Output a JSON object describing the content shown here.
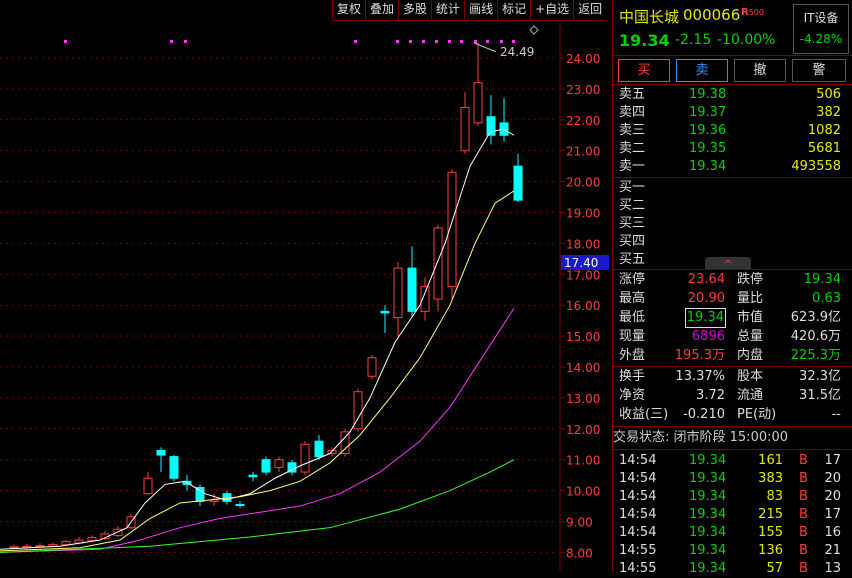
{
  "toolbar": {
    "items": [
      "复权",
      "叠加",
      "多股",
      "统计",
      "画线",
      "标记",
      "+自选",
      "返回"
    ]
  },
  "chart": {
    "price_labels": [
      "24.00",
      "23.00",
      "22.00",
      "21.00",
      "20.00",
      "19.00",
      "18.00",
      "17.00",
      "16.00",
      "15.00",
      "14.00",
      "13.00",
      "12.00",
      "11.00",
      "10.00",
      "9.00",
      "8.00"
    ],
    "current_price_tag": "17.40",
    "high_annotation": "24.49",
    "colors": {
      "up": "#ff3b3b",
      "down": "#00ffff",
      "ma5": "#ffffff",
      "ma10": "#ffff66",
      "ma20": "#ff33ff",
      "ma60": "#33ff33"
    }
  },
  "quote": {
    "name": "中国长城",
    "code": "000066",
    "r_badge": "R",
    "r_value": "500",
    "price": "19.34",
    "change": "-2.15",
    "change_pct": "-10.00%",
    "sector_name": "IT设备",
    "sector_pct": "-4.28%"
  },
  "actions": {
    "buy": "买",
    "sell": "卖",
    "cancel": "撤",
    "alert": "警"
  },
  "asks": [
    {
      "label": "卖五",
      "price": "19.38",
      "vol": "506"
    },
    {
      "label": "卖四",
      "price": "19.37",
      "vol": "382"
    },
    {
      "label": "卖三",
      "price": "19.36",
      "vol": "1082"
    },
    {
      "label": "卖二",
      "price": "19.35",
      "vol": "5681"
    },
    {
      "label": "卖一",
      "price": "19.34",
      "vol": "493558"
    }
  ],
  "bids": [
    {
      "label": "买一"
    },
    {
      "label": "买二"
    },
    {
      "label": "买三"
    },
    {
      "label": "买四"
    },
    {
      "label": "买五"
    }
  ],
  "expand_icon": "^",
  "stats": [
    {
      "l1": "涨停",
      "v1": "23.64",
      "c1": "red",
      "l2": "跌停",
      "v2": "19.34",
      "c2": "green"
    },
    {
      "l1": "最高",
      "v1": "20.90",
      "c1": "red",
      "l2": "量比",
      "v2": "0.63",
      "c2": "green"
    },
    {
      "l1": "最低",
      "v1": "19.34",
      "c1": "green",
      "l2": "市值",
      "v2": "623.9亿",
      "c2": "white"
    },
    {
      "l1": "现量",
      "v1": "6896",
      "c1": "magenta",
      "l2": "总量",
      "v2": "420.6万",
      "c2": "white"
    },
    {
      "l1": "外盘",
      "v1": "195.3万",
      "c1": "red",
      "l2": "内盘",
      "v2": "225.3万",
      "c2": "green"
    }
  ],
  "fundamentals": [
    {
      "l1": "换手",
      "v1": "13.37%",
      "l2": "股本",
      "v2": "32.3亿"
    },
    {
      "l1": "净资",
      "v1": "3.72",
      "l2": "流通",
      "v2": "31.5亿"
    },
    {
      "l1": "收益(三)",
      "v1": "-0.210",
      "l2": "PE(动)",
      "v2": "--"
    }
  ],
  "trade_status": "交易状态: 闭市阶段 15:00:00",
  "ticks": [
    {
      "time": "14:54",
      "price": "19.34",
      "vol": "161",
      "side": "B",
      "n": "17"
    },
    {
      "time": "14:54",
      "price": "19.34",
      "vol": "383",
      "side": "B",
      "n": "20"
    },
    {
      "time": "14:54",
      "price": "19.34",
      "vol": "83",
      "side": "B",
      "n": "20"
    },
    {
      "time": "14:54",
      "price": "19.34",
      "vol": "215",
      "side": "B",
      "n": "17"
    },
    {
      "time": "14:54",
      "price": "19.34",
      "vol": "155",
      "side": "B",
      "n": "16"
    },
    {
      "time": "14:55",
      "price": "19.34",
      "vol": "136",
      "side": "B",
      "n": "21"
    },
    {
      "time": "14:55",
      "price": "19.34",
      "vol": "57",
      "side": "B",
      "n": "13"
    }
  ]
}
